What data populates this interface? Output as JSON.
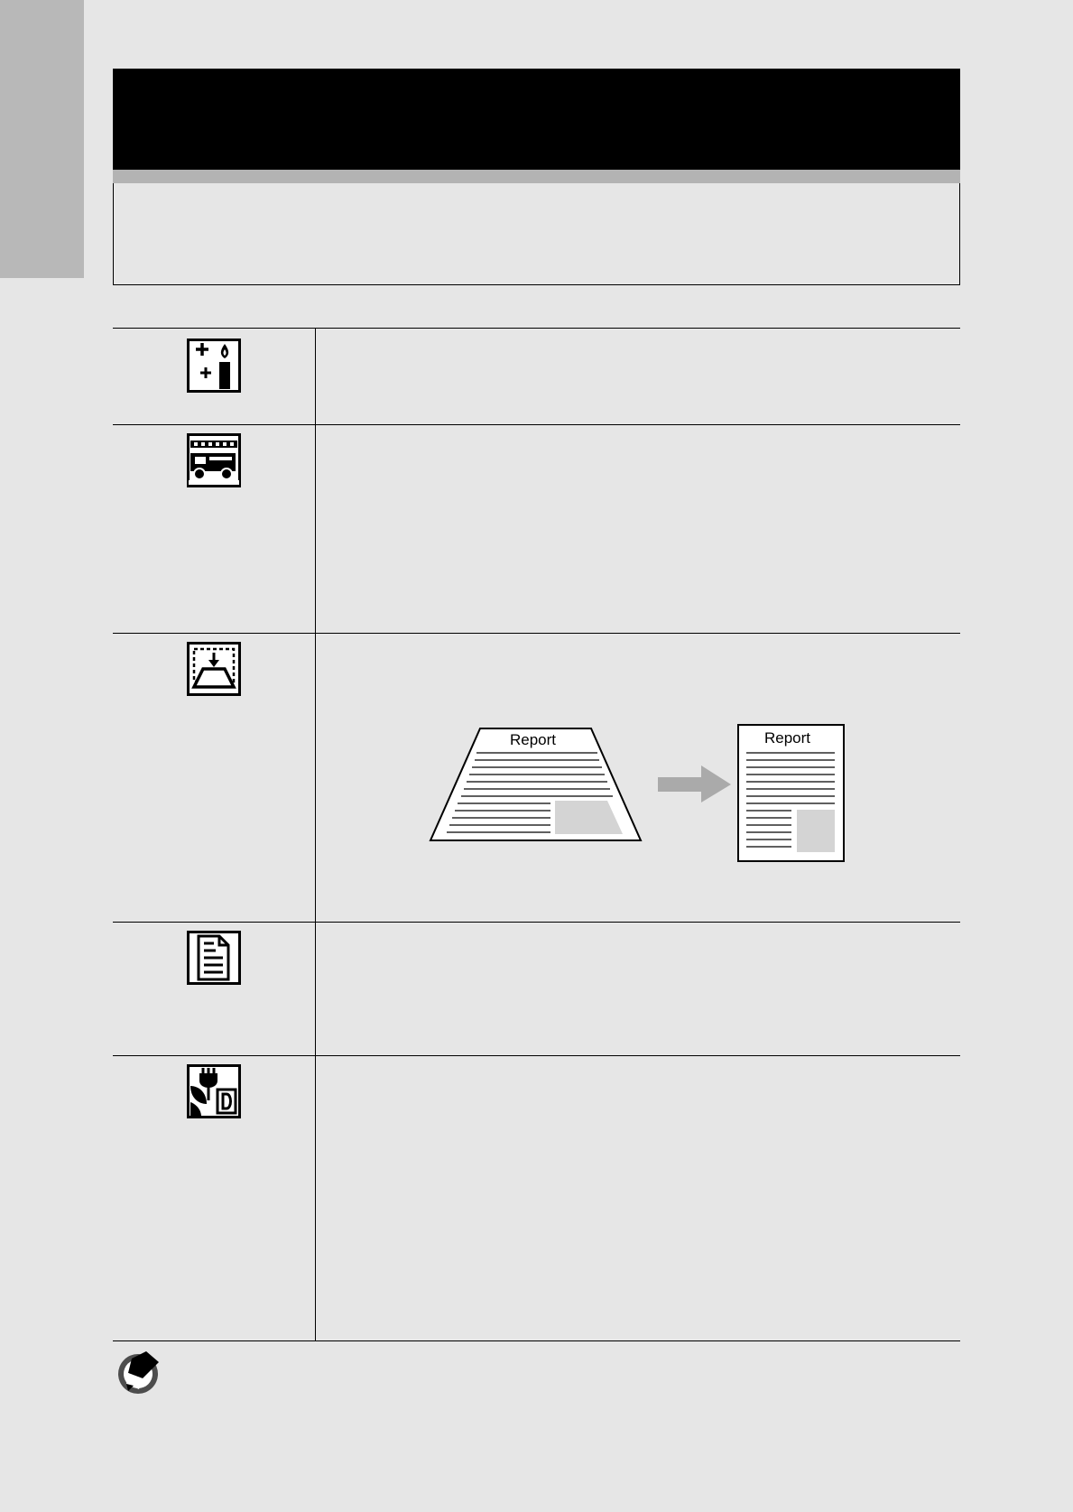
{
  "modes": [
    {
      "icon": "candlelight-icon"
    },
    {
      "icon": "fire-truck-sports-icon"
    },
    {
      "icon": "skew-correction-icon"
    },
    {
      "icon": "text-document-icon"
    },
    {
      "icon": "plant-flower-icon"
    }
  ],
  "skew_diagram": {
    "before_label": "Report",
    "after_label": "Report",
    "arrow_color": "#aaaaaa",
    "image_fill_color": "#d4d4d4"
  },
  "note": {
    "icon": "note-pencil-icon"
  },
  "colors": {
    "page_background": "#e6e6e6",
    "title_bar": "#000000",
    "title_stripe": "#b3b3b3",
    "side_tab": "#b8b8b8"
  }
}
